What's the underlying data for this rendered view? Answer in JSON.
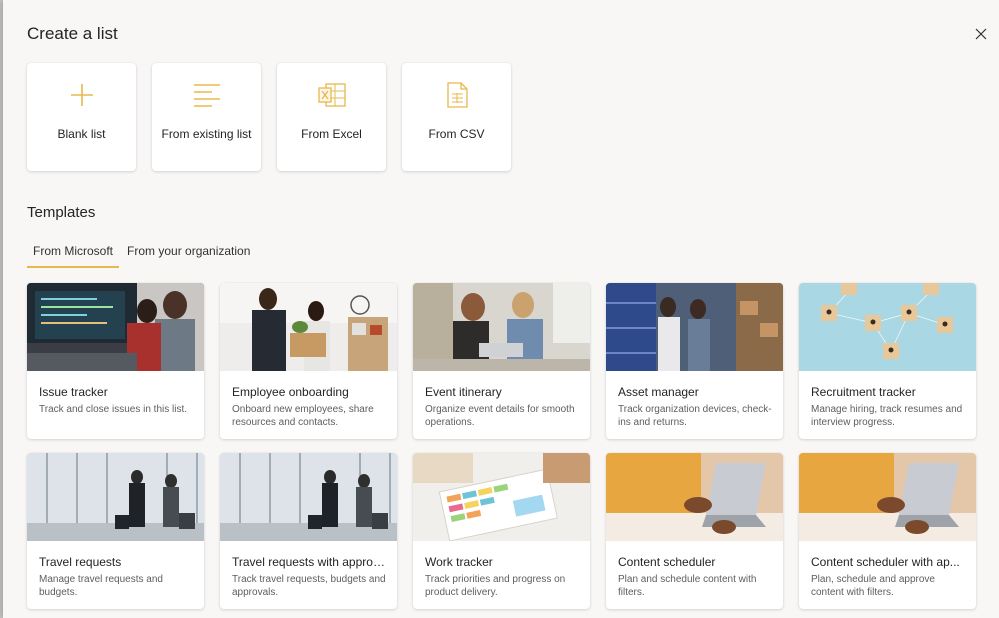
{
  "dialog": {
    "title": "Create a list",
    "close_icon": "close-icon"
  },
  "create_options": [
    {
      "label": "Blank list",
      "icon": "plus-icon"
    },
    {
      "label": "From existing list",
      "icon": "list-lines-icon"
    },
    {
      "label": "From Excel",
      "icon": "excel-icon"
    },
    {
      "label": "From CSV",
      "icon": "csv-file-icon"
    }
  ],
  "templates": {
    "title": "Templates",
    "tabs": [
      {
        "label": "From Microsoft",
        "active": true
      },
      {
        "label": "From your organization",
        "active": false
      }
    ],
    "cards": [
      {
        "name": "Issue tracker",
        "description": "Track and close issues in this list."
      },
      {
        "name": "Employee onboarding",
        "description": "Onboard new employees, share resources and contacts."
      },
      {
        "name": "Event itinerary",
        "description": "Organize event details for smooth operations."
      },
      {
        "name": "Asset manager",
        "description": "Track organization devices, check-ins and returns."
      },
      {
        "name": "Recruitment tracker",
        "description": "Manage hiring, track resumes and interview progress."
      },
      {
        "name": "Travel requests",
        "description": "Manage travel requests and budgets."
      },
      {
        "name": "Travel requests with approv...",
        "description": "Track travel requests, budgets and approvals."
      },
      {
        "name": "Work tracker",
        "description": "Track priorities and progress on product delivery."
      },
      {
        "name": "Content scheduler",
        "description": "Plan and schedule content with filters."
      },
      {
        "name": "Content scheduler with ap...",
        "description": "Plan, schedule and approve content with filters."
      }
    ]
  },
  "colors": {
    "accent": "#e8b84f",
    "panel_bg": "#f8f7f6",
    "card_bg": "#ffffff"
  }
}
